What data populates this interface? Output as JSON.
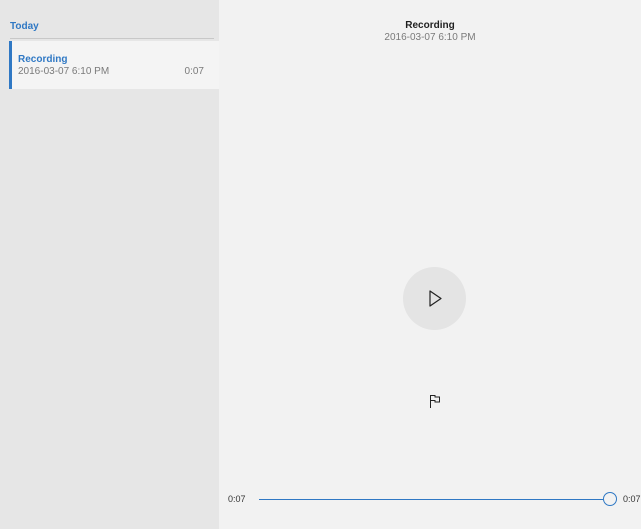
{
  "sidebar": {
    "group_header": "Today",
    "items": [
      {
        "title": "Recording",
        "date": "2016-03-07 6:10 PM",
        "duration": "0:07",
        "selected": true
      }
    ]
  },
  "player": {
    "title": "Recording",
    "date": "2016-03-07 6:10 PM",
    "play_icon": "play-icon",
    "flag_icon": "flag-icon",
    "current_time": "0:07",
    "total_time": "0:07",
    "progress_fraction": 1.0
  },
  "colors": {
    "accent": "#2f78c4",
    "sidebar_bg": "#e6e6e6",
    "main_bg": "#f2f2f2"
  }
}
